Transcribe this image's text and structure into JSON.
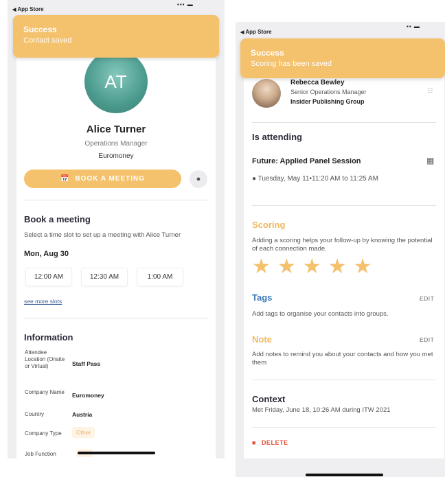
{
  "left": {
    "status_back": "App Store",
    "toast": {
      "title": "Success",
      "message": "Contact saved"
    },
    "avatar_initials": "AT",
    "name": "Alice Turner",
    "role": "Operations Manager",
    "company": "Euromoney",
    "book_button": "BOOK A MEETING",
    "book_section": {
      "title": "Book a meeting",
      "subtitle": "Select a time slot to set up a meeting with Alice Turner",
      "date": "Mon, Aug 30",
      "slots": [
        "12:00 AM",
        "12:30 AM",
        "1:00 AM"
      ],
      "more_link": "see more slots"
    },
    "information": {
      "title": "Information",
      "rows": [
        {
          "label": "Attendee Location (Onsite or Virtual)",
          "value": "Staff Pass"
        },
        {
          "label": "Company Name",
          "value": "Euromoney"
        },
        {
          "label": "Country",
          "value": "Austria"
        },
        {
          "label": "Company Type",
          "value": "Other"
        },
        {
          "label": "Job Function",
          "value": ""
        }
      ]
    }
  },
  "right": {
    "status_back": "App Store",
    "toast": {
      "title": "Success",
      "message": "Scoring has been saved"
    },
    "profile": {
      "name": "Rebecca Bewley",
      "title": "Senior Operations Manager",
      "company": "Insider Publishing Group"
    },
    "attending": {
      "heading": "Is attending",
      "session": "Future: Applied Panel Session",
      "time": "Tuesday, May 11•11:20 AM to 11:25 AM"
    },
    "scoring": {
      "heading": "Scoring",
      "description": "Adding a scoring helps your follow-up by knowing the potential of each connection made.",
      "rating": 5,
      "max_rating": 5
    },
    "tags": {
      "heading": "Tags",
      "edit": "EDIT",
      "description": "Add tags to organise your contacts into groups."
    },
    "note": {
      "heading": "Note",
      "edit": "EDIT",
      "description": "Add notes to remind you about your contacts and how you met them"
    },
    "context": {
      "heading": "Context",
      "text": "Met Friday, June 18, 10:26 AM during ITW 2021"
    },
    "delete_label": "DELETE"
  },
  "colors": {
    "accent": "#f4c16c",
    "link": "#3a5e95",
    "tags_heading": "#3d79b8",
    "delete": "#e0533a"
  }
}
